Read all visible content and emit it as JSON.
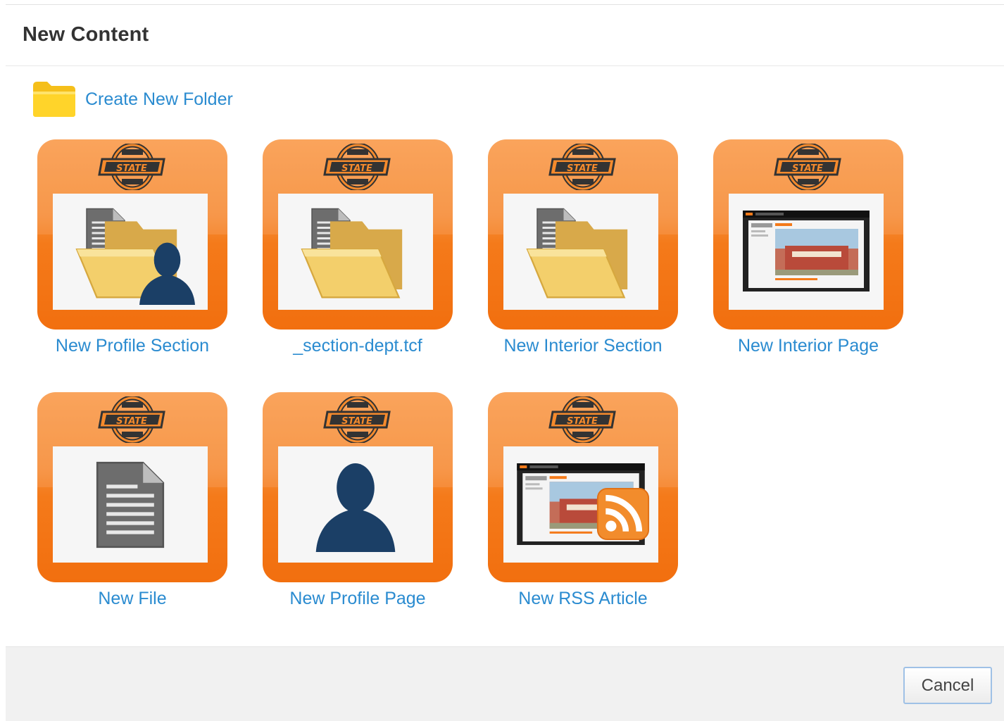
{
  "dialog": {
    "title": "New Content"
  },
  "create_folder": {
    "label": "Create New Folder",
    "icon": "folder-icon"
  },
  "tiles": [
    {
      "label": "New Profile Section",
      "icon": "folder-with-document-and-person-icon"
    },
    {
      "label": "_section-dept.tcf",
      "icon": "folder-with-document-icon"
    },
    {
      "label": "New Interior Section",
      "icon": "folder-with-document-icon"
    },
    {
      "label": "New Interior Page",
      "icon": "webpage-screenshot-icon"
    },
    {
      "label": "New File",
      "icon": "document-icon"
    },
    {
      "label": "New Profile Page",
      "icon": "person-silhouette-icon"
    },
    {
      "label": "New RSS Article",
      "icon": "webpage-rss-icon"
    }
  ],
  "footer": {
    "cancel_label": "Cancel"
  },
  "colors": {
    "tile_orange": "#f47a1a",
    "link_blue": "#2a8bd0",
    "title_text": "#333333",
    "footer_bg": "#f1f1f1",
    "person_navy": "#1b3f66"
  }
}
